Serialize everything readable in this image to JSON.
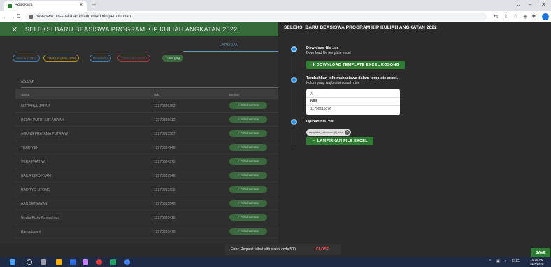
{
  "browser": {
    "tab_title": "Beasiswa",
    "tab_close": "×",
    "new_tab": "+",
    "url": "beasiswa.uin-suska.ac.id/admin/admin/pemohonan",
    "win_min": "–",
    "win_max": "⌄",
    "win_close": "✕"
  },
  "modal": {
    "close": "✕",
    "title": "SELEKSI BARU BEASISWA PROGRAM KIP KULIAH ANGKATAN 2022"
  },
  "tabs": {
    "laporan": "LAPORAN"
  },
  "chips": [
    {
      "label": "Semua (1481)",
      "color": "#4a7fb0"
    },
    {
      "label": "Tidak Lengkap (209)",
      "color": "#b59428"
    },
    {
      "label": "Proses (0)",
      "color": "#4a7fb0"
    },
    {
      "label": "Tidak Lulus (1226)",
      "color": "#a23e3e"
    },
    {
      "label": "Lulus (50)",
      "color": "#3c6a3e",
      "filled": true
    }
  ],
  "search": {
    "label": "Search"
  },
  "table": {
    "headers": {
      "name": "Nama",
      "nim": "NIM",
      "berkas": "Berkas"
    },
    "rows": [
      {
        "name": "MIFTAHUL JANNA",
        "nim": "12270320252",
        "status": "✓  Administrator"
      },
      {
        "name": "INDAH PUTRI SITI AISYAH",
        "nim": "12270325612",
        "status": "✓  Administrator"
      },
      {
        "name": "AGUNG PRATAMA PUTRA W",
        "nim": "12270313367",
        "status": "✓  Administrator"
      },
      {
        "name": "TERDIYEN",
        "nim": "12270324246",
        "status": "✓  Administrator"
      },
      {
        "name": "VERA PRATIWI",
        "nim": "12270324270",
        "status": "✓  Administrator"
      },
      {
        "name": "NAILA ISROFIYANI",
        "nim": "12270327946",
        "status": "✓  Administrator"
      },
      {
        "name": "RADITYO UTOMO",
        "nim": "12270313938",
        "status": "✓  Administrator"
      },
      {
        "name": "AAN SETIAWAN",
        "nim": "12270315540",
        "status": "✓  Administrator"
      },
      {
        "name": "Novita Rizky Ramadhani",
        "nim": "12270320418",
        "status": "✓  Administrator"
      },
      {
        "name": "Ramadayani",
        "nim": "12270320470",
        "status": "✓  Administrator"
      }
    ]
  },
  "panel": {
    "title": "SELEKSI BARU BEASISWA PROGRAM KIP KULIAH ANGKATAN 2022",
    "step1": {
      "title": "Download file .xls",
      "subtitle": "Download file template excel",
      "button": "⬇  DOWNLOAD TEMPLATE EXCEL KOSONG"
    },
    "step2": {
      "title": "Tambahkan info mahasiswa dalam template excel.",
      "subtitle": "Kolom yang wajib diisi adalah nim",
      "cell_col": "A",
      "cell_header": "NIM",
      "cell_value": "11750115076"
    },
    "step3": {
      "title": "Upload file .xls",
      "file_chip": "template_kelulusan (9).xlsx",
      "file_remove": "✕",
      "button": "⇔  LAMPIRKAN FILE EXCEL"
    },
    "save": "SAVE"
  },
  "snackbar": {
    "message": "Error: Request failed with status code 500",
    "action": "CLOSE"
  },
  "taskbar": {
    "lang": "ENG",
    "time": "10:18 AM",
    "date": "11/7/2022"
  }
}
